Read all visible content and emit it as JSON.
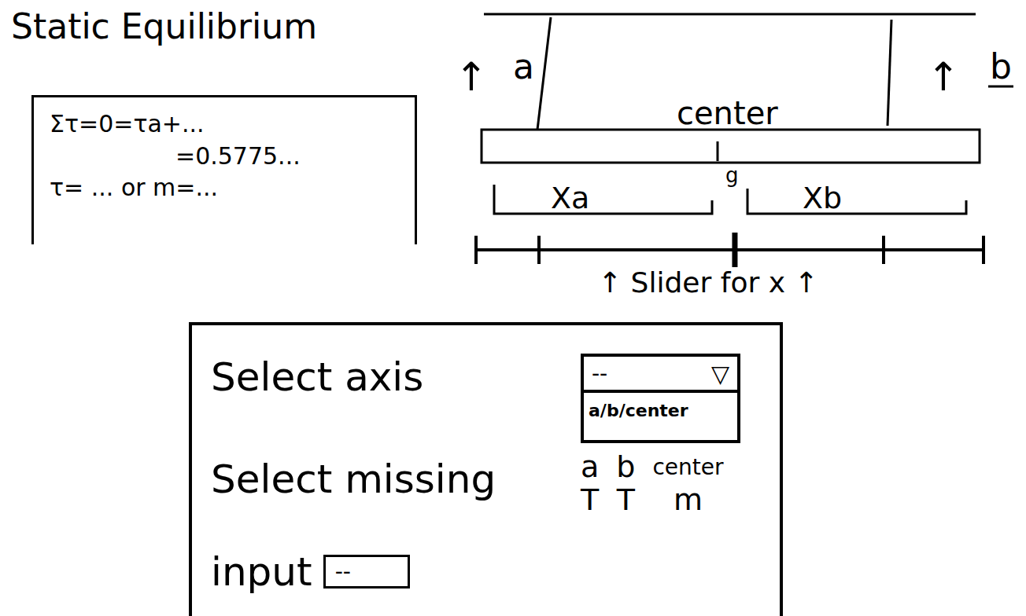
{
  "title": "Static Equilibrium",
  "formula": {
    "lines": [
      "Στ=0=τa+...",
      "=0.5775...",
      "τ= ... or m=..."
    ]
  },
  "diagram": {
    "strings": [
      {
        "label": "a",
        "arrow": "↑"
      },
      {
        "label": "b",
        "arrow": "↑"
      }
    ],
    "center_label": "center",
    "g_label": "g",
    "distances": [
      "Xa",
      "Xb"
    ],
    "slider": {
      "label": "Slider for x",
      "arrow": "↑",
      "level": 0.51
    }
  },
  "panel": {
    "axis": {
      "label": "Select axis",
      "value": "--",
      "arrow": "▽",
      "options_text": "a/b/center",
      "expanded": true
    },
    "missing": {
      "label": "Select missing",
      "options": [
        {
          "name": "a",
          "unit": "T"
        },
        {
          "name": "b",
          "unit": "T"
        },
        {
          "name": "center",
          "unit": "m"
        }
      ]
    },
    "input": {
      "label": "input",
      "value": "--"
    }
  }
}
